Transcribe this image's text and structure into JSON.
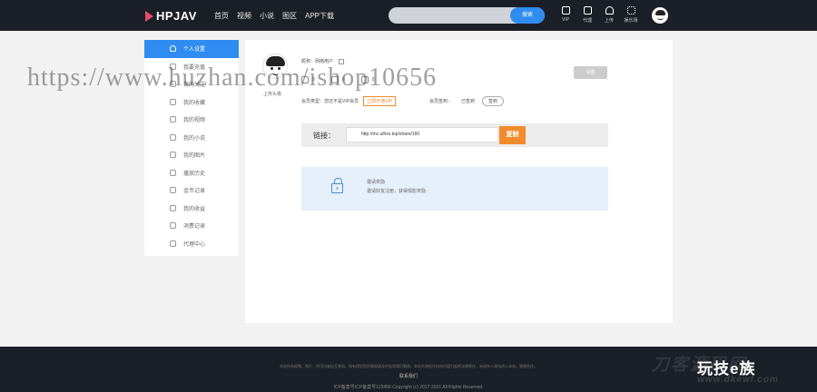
{
  "brand": {
    "logo_text": "HPJAV",
    "accent": "#e94b6a"
  },
  "nav": {
    "items": [
      "首页",
      "视频",
      "小说",
      "图区",
      "APP下载"
    ]
  },
  "search": {
    "placeholder": "",
    "button_label": "搜索"
  },
  "header_tools": [
    {
      "label": "VIP",
      "icon": "vip-icon"
    },
    {
      "label": "代理",
      "icon": "agent-icon"
    },
    {
      "label": "上传",
      "icon": "upload-icon"
    },
    {
      "label": "娱乐场",
      "icon": "grid-icon"
    }
  ],
  "sidebar": {
    "items": [
      {
        "label": "个人设置",
        "icon": "user-icon",
        "active": true
      },
      {
        "label": "我要充值",
        "icon": "recharge-icon",
        "active": false
      },
      {
        "label": "我的关注",
        "icon": "follow-icon",
        "active": false
      },
      {
        "label": "我的收藏",
        "icon": "star-icon",
        "active": false
      },
      {
        "label": "我的视频",
        "icon": "video-icon",
        "active": false
      },
      {
        "label": "我的小说",
        "icon": "book-icon",
        "active": false
      },
      {
        "label": "我的图片",
        "icon": "image-icon",
        "active": false
      },
      {
        "label": "播放历史",
        "icon": "history-icon",
        "active": false
      },
      {
        "label": "金币记录",
        "icon": "coin-icon",
        "active": false
      },
      {
        "label": "我的收益",
        "icon": "income-icon",
        "active": false
      },
      {
        "label": "消费记录",
        "icon": "receipt-icon",
        "active": false
      },
      {
        "label": "代理中心",
        "icon": "agent-icon",
        "active": false
      }
    ]
  },
  "profile": {
    "upload_avatar_label": "上传头像",
    "nickname_text": "昵称：网络用户",
    "stats": [
      {
        "label": "金币",
        "value": "0"
      },
      {
        "label": "积分",
        "value": "0"
      },
      {
        "label": "观看",
        "value": "0"
      }
    ],
    "member_type_text": "会员类型：您还不是VIP会员",
    "open_vip_label": "立即开通VIP",
    "signin_label": "会员签到：",
    "signin_status": "已签到",
    "signin_button": "签到",
    "settings_button": "设置"
  },
  "promo_link": {
    "label": "链接：",
    "value": "http://mc.ulhxx.top/share/160",
    "copy_label": "复制"
  },
  "invite": {
    "title": "邀请奖励",
    "description": "邀请好友注册，获得观影奖励"
  },
  "footer": {
    "disclaimer": "本站所有视频、图片、资讯均来自互联网，如有侵犯您的版权请及时告知我们删除。本站不承担任何由内容引起的法律责任，未成年人请勿进入本站，谢谢合作。",
    "link": "联系我们",
    "copyright": "ICP备案号ICP备案号123456  Copyright (c) 2017-2021 All Rights Reserved."
  },
  "overlay_watermark": "https://www.huzhan.com/ishop10656",
  "footer_watermarks": {
    "large": "刀客源码网",
    "brand": "玩技e族",
    "url": "www.dkewl.com"
  },
  "colors": {
    "primary": "#2f8cf0",
    "orange": "#f08c2c",
    "dark": "#1b1f27"
  }
}
